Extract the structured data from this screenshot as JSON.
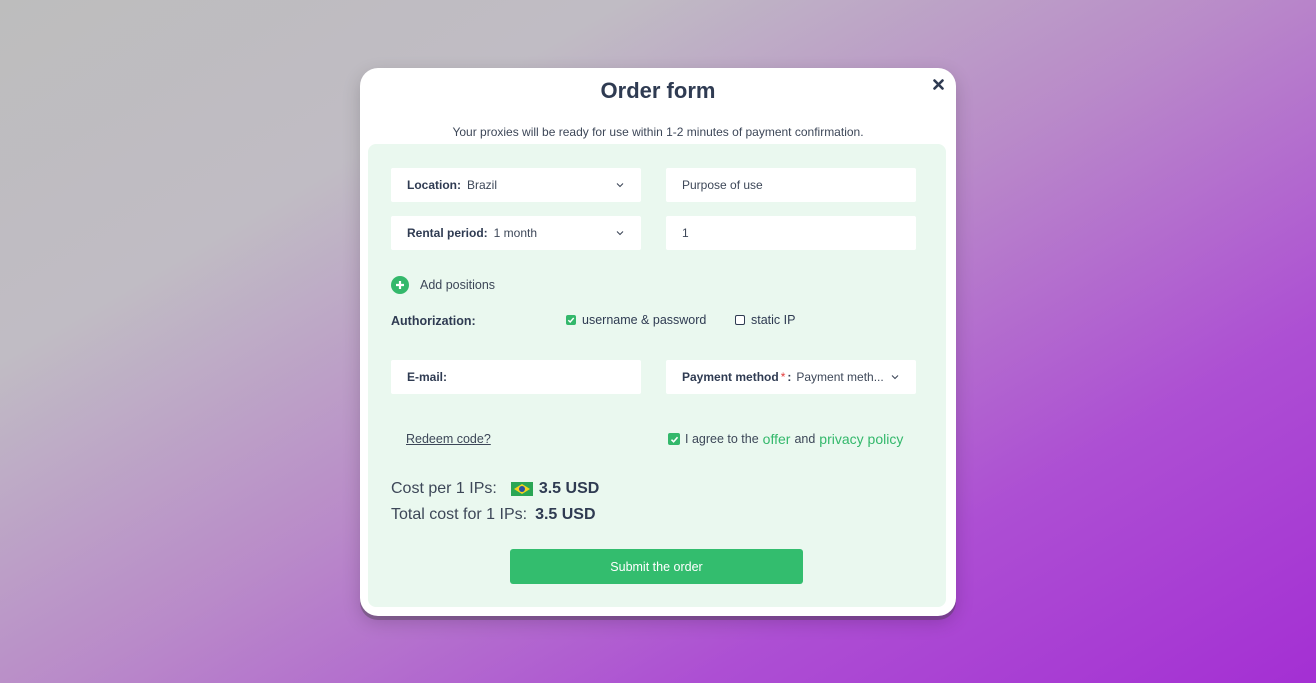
{
  "modal": {
    "title": "Order form",
    "subtitle": "Your proxies will be ready for use within 1-2 minutes of payment confirmation."
  },
  "form": {
    "location": {
      "label": "Location:",
      "value": "Brazil"
    },
    "purpose": {
      "placeholder": "Purpose of use"
    },
    "rental_period": {
      "label": "Rental period:",
      "value": "1 month"
    },
    "quantity": {
      "value": "1"
    },
    "add_positions": "Add positions",
    "authorization": {
      "label": "Authorization:",
      "options": [
        {
          "label": "username & password",
          "checked": true
        },
        {
          "label": "static IP",
          "checked": false
        }
      ]
    },
    "email": {
      "label": "E-mail:"
    },
    "payment": {
      "label": "Payment method",
      "required_mark": "*",
      "colon": ":",
      "value": "Payment meth..."
    },
    "redeem": "Redeem code?",
    "agree": {
      "checked": true,
      "text1": "I agree to the",
      "offer": "offer",
      "text2": "and",
      "privacy": "privacy policy"
    }
  },
  "cost": {
    "per_label": "Cost per 1 IPs:",
    "per_value": "3.5 USD",
    "total_label": "Total cost for 1 IPs:",
    "total_value": "3.5 USD",
    "flag_icon": "brazil-flag-icon"
  },
  "submit_label": "Submit the order",
  "colors": {
    "accent": "#33bd6e",
    "panel_bg": "#eaf8ef",
    "text_dark": "#2f3b52",
    "required": "#e23a3a"
  }
}
